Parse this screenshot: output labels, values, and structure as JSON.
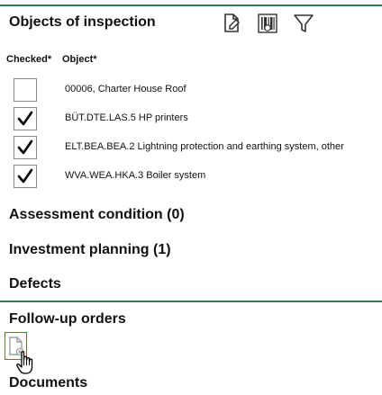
{
  "sections": {
    "objects_title": "Objects of inspection",
    "assessment_title": "Assessment condition (0)",
    "investment_title": "Investment planning (1)",
    "defects_title": "Defects",
    "followup_title": "Follow-up orders",
    "documents_title": "Documents"
  },
  "toolbar": {
    "icons": [
      "document-edit-icon",
      "barcode-scan-icon",
      "filter-icon"
    ]
  },
  "table": {
    "headers": {
      "checked": "Checked*",
      "object": "Object*"
    },
    "rows": [
      {
        "checked": false,
        "object": "00006, Charter House Roof"
      },
      {
        "checked": true,
        "object": "BÜT.DTE.LAS.5 HP printers"
      },
      {
        "checked": true,
        "object": "ELT.BEA.BEA.2 Lightning protection and earthing system, other"
      },
      {
        "checked": true,
        "object": "WVA.WEA.HKA.3 Boiler system"
      }
    ]
  },
  "followup": {
    "add_icon": "add-document-icon"
  },
  "colors": {
    "accent_rule": "#2e7d4f",
    "highlight": "#e53935"
  }
}
